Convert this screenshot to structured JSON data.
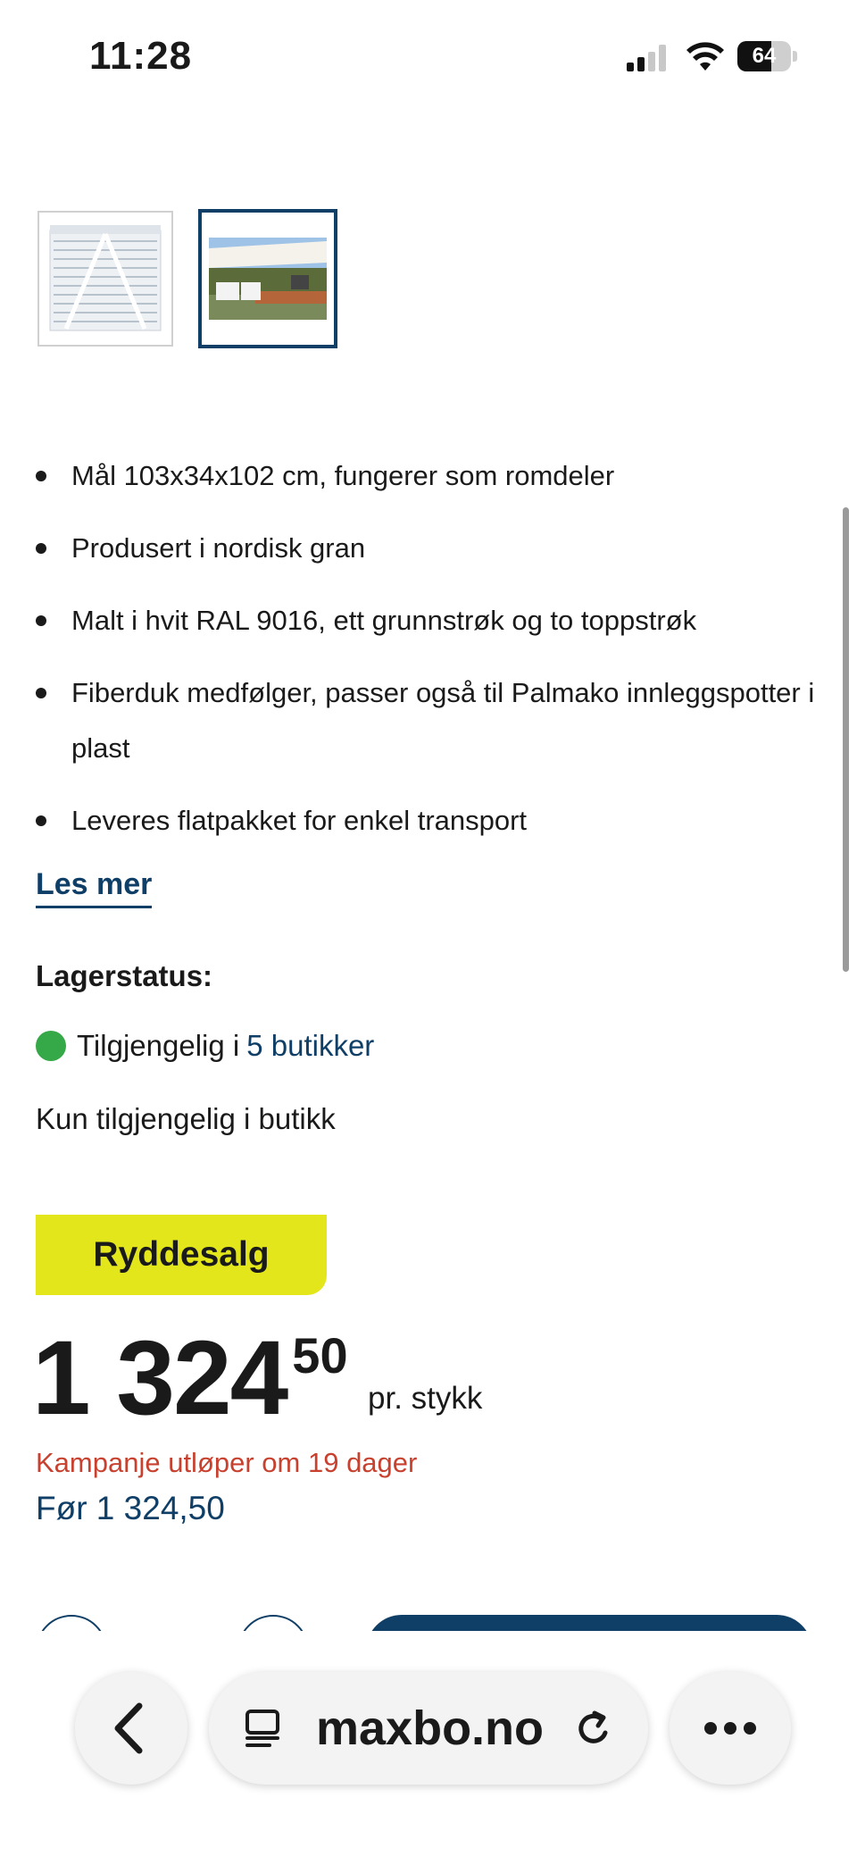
{
  "status_bar": {
    "time": "11:28",
    "battery_percent": "64",
    "battery_level": 0.64,
    "icons": [
      "cellular-signal-icon",
      "wifi-icon",
      "battery-icon"
    ]
  },
  "gallery": {
    "thumbnails": [
      {
        "name": "white-planter-thumbnail",
        "selected": false
      },
      {
        "name": "terrace-photo-thumbnail",
        "selected": true
      }
    ]
  },
  "product": {
    "features": [
      "Mål 103x34x102 cm, fungerer som romdeler",
      "Produsert i nordisk gran",
      "Malt i hvit RAL 9016, ett grunnstrøk og to toppstrøk",
      "Fiberduk medfølger, passer også til Palmako innleggspotter i plast",
      "Leveres flatpakket for enkel transport"
    ],
    "read_more_label": "Les mer"
  },
  "stock": {
    "heading": "Lagerstatus:",
    "availability_prefix": "Tilgjengelig i",
    "availability_link": "5 butikker",
    "store_only_note": "Kun tilgjengelig i butikk",
    "status_color": "#35a847"
  },
  "pricing": {
    "badge": "Ryddesalg",
    "badge_color": "#e2e61b",
    "price_main": "1 324",
    "price_decimals": "50",
    "unit": "pr. stykk",
    "campaign_text": "Kampanje utløper om 19 dager",
    "before_price": "Før 1 324,50"
  },
  "browser": {
    "url": "maxbo.no",
    "icons": [
      "back-chevron-icon",
      "tabs-icon",
      "reload-icon",
      "more-dots-icon"
    ]
  },
  "colors": {
    "accent": "#0f3e66",
    "campaign": "#c8412f"
  }
}
